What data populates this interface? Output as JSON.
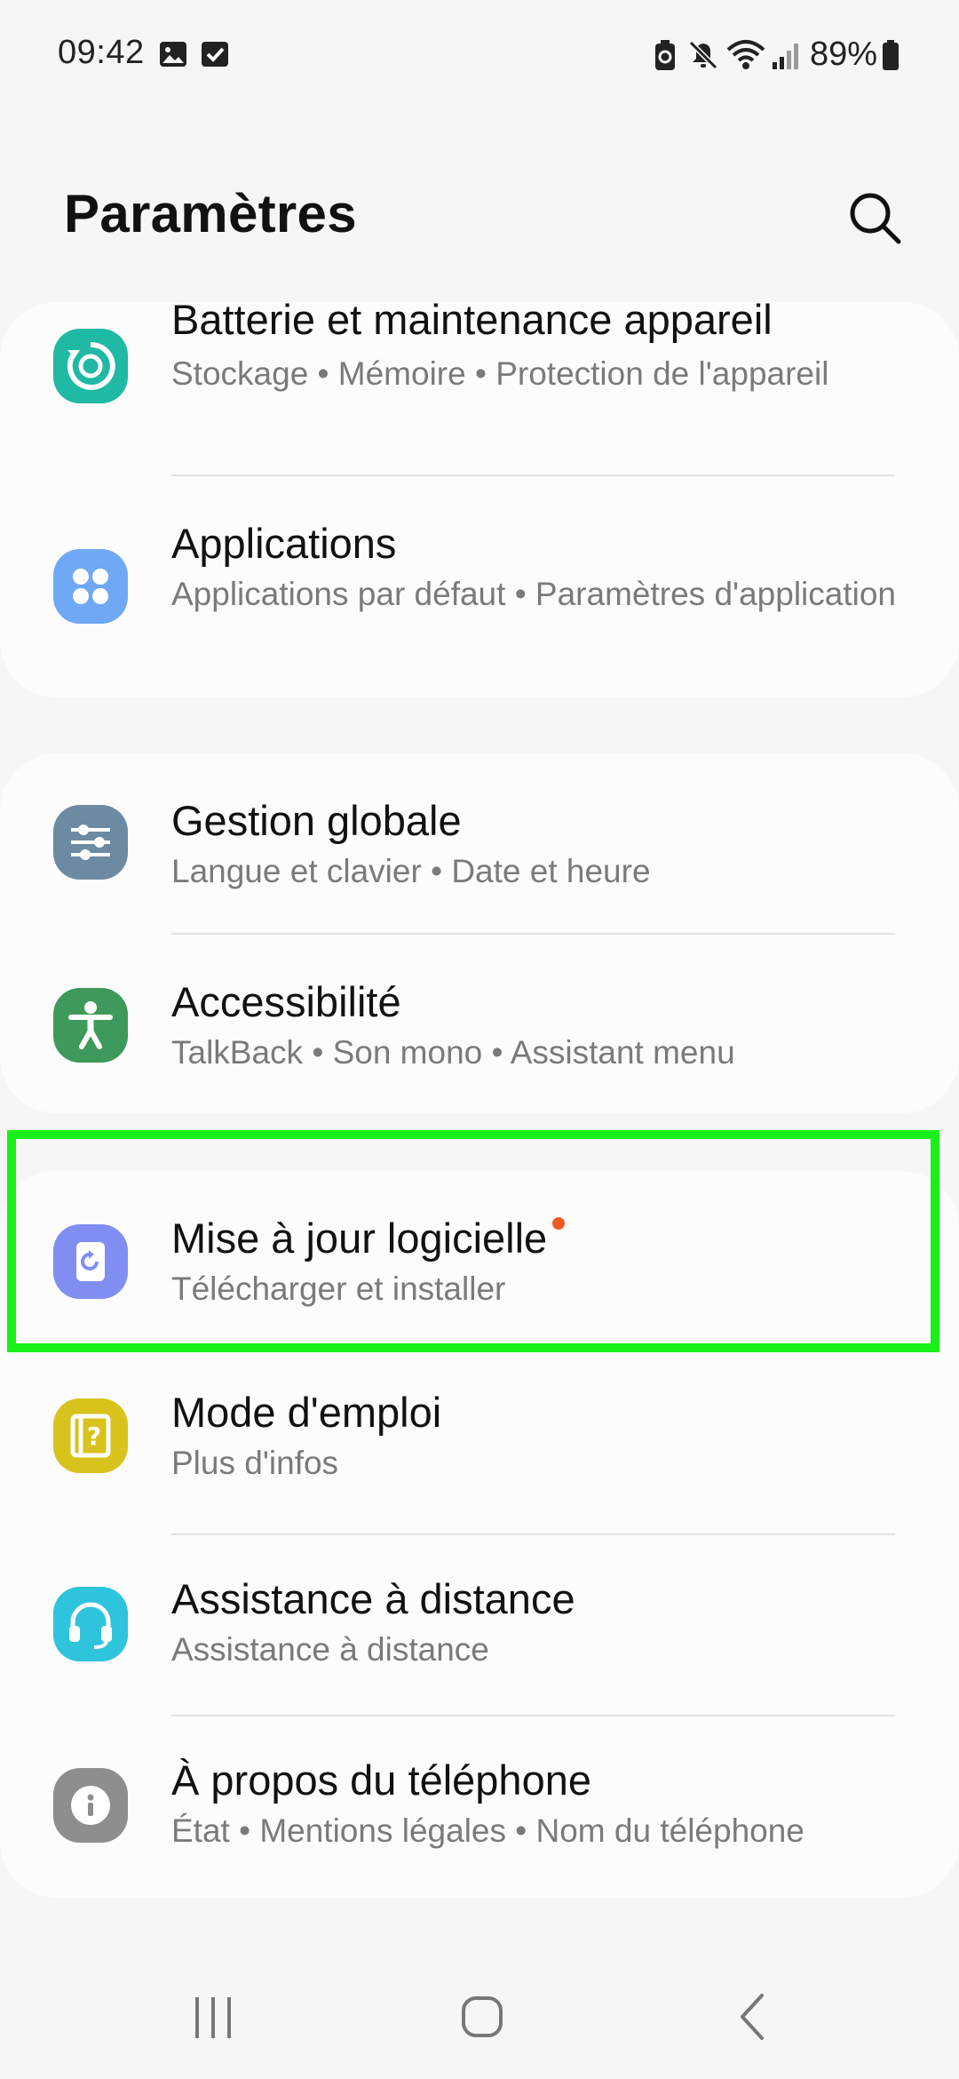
{
  "status_bar": {
    "time": "09:42",
    "battery": "89%",
    "icons": [
      "image-icon",
      "check-box-icon",
      "battery-saver-icon",
      "mute-icon",
      "wifi-icon",
      "signal-icon",
      "battery-icon"
    ]
  },
  "header": {
    "title": "Paramètres",
    "search_icon": "search-icon"
  },
  "groups": [
    {
      "items": [
        {
          "title": "Batterie et maintenance appareil",
          "subtitle": "Stockage  •  Mémoire  •  Protection de l'appareil",
          "icon": "battery-care-icon",
          "icon_color": "#1fb9a4"
        },
        {
          "title": "Applications",
          "subtitle": "Applications par défaut  •  Paramètres d'application",
          "icon": "apps-grid-icon",
          "icon_color": "#6fa8f5"
        }
      ]
    },
    {
      "items": [
        {
          "title": "Gestion globale",
          "subtitle": "Langue et clavier  •  Date et heure",
          "icon": "sliders-icon",
          "icon_color": "#6d8aa3"
        },
        {
          "title": "Accessibilité",
          "subtitle": "TalkBack  •  Son mono  •  Assistant menu",
          "icon": "accessibility-icon",
          "icon_color": "#3e9a5a"
        }
      ]
    },
    {
      "items": [
        {
          "title": "Mise à jour logicielle",
          "subtitle": "Télécharger et installer",
          "icon": "software-update-icon",
          "icon_color": "#7f8ef0",
          "badge_color": "#ef5a24"
        },
        {
          "title": "Mode d'emploi",
          "subtitle": "Plus d'infos",
          "icon": "user-manual-icon",
          "icon_color": "#d8c21c"
        },
        {
          "title": "Assistance à distance",
          "subtitle": "Assistance à distance",
          "icon": "headset-icon",
          "icon_color": "#2ec4dc"
        },
        {
          "title": "À propos du téléphone",
          "subtitle": "État  •  Mentions légales  •  Nom du téléphone",
          "icon": "info-icon",
          "icon_color": "#8e8e8e"
        }
      ]
    }
  ],
  "highlight_color": "#18f018",
  "nav_bar": {
    "buttons": [
      "recent-apps-icon",
      "home-icon",
      "back-icon"
    ]
  }
}
